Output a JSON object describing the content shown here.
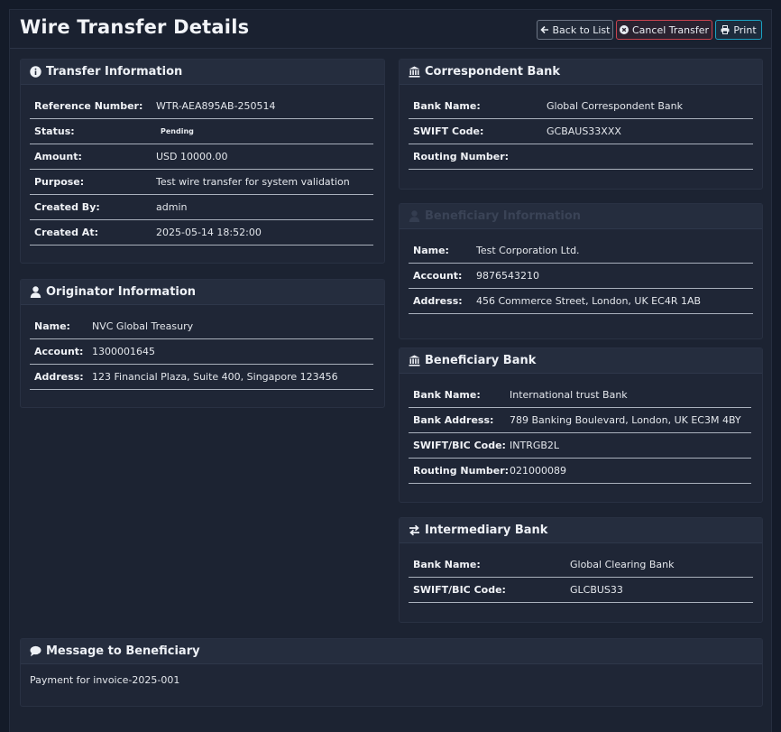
{
  "page": {
    "title": "Wire Transfer Details",
    "buttons": {
      "back": "Back to List",
      "cancel": "Cancel Transfer",
      "print": "Print"
    }
  },
  "transfer": {
    "title": "Transfer Information",
    "labels": {
      "reference": "Reference Number:",
      "status": "Status:",
      "amount": "Amount:",
      "purpose": "Purpose:",
      "created_by": "Created By:",
      "created_at": "Created At:"
    },
    "values": {
      "reference": "WTR-AEA895AB-250514",
      "status": "Pending",
      "amount": "USD 10000.00",
      "purpose": "Test wire transfer for system validation",
      "created_by": "admin",
      "created_at": "2025-05-14 18:52:00"
    }
  },
  "originator": {
    "title": "Originator Information",
    "labels": {
      "name": "Name:",
      "account": "Account:",
      "address": "Address:"
    },
    "values": {
      "name": "NVC Global Treasury",
      "account": "1300001645",
      "address": "123 Financial Plaza, Suite 400, Singapore 123456"
    }
  },
  "correspondent": {
    "title": "Correspondent Bank",
    "labels": {
      "bank_name": "Bank Name:",
      "swift": "SWIFT Code:",
      "routing": "Routing Number:"
    },
    "values": {
      "bank_name": "Global Correspondent Bank",
      "swift": "GCBAUS33XXX",
      "routing": ""
    }
  },
  "beneficiary": {
    "title": "Beneficiary Information",
    "labels": {
      "name": "Name:",
      "account": "Account:",
      "address": "Address:"
    },
    "values": {
      "name": "Test Corporation Ltd.",
      "account": "9876543210",
      "address": "456 Commerce Street, London, UK EC4R 1AB"
    }
  },
  "beneficiary_bank": {
    "title": "Beneficiary Bank",
    "labels": {
      "bank_name": "Bank Name:",
      "bank_address": "Bank Address:",
      "swift": "SWIFT/BIC Code:",
      "routing": "Routing Number:"
    },
    "values": {
      "bank_name": "International trust Bank",
      "bank_address": "789 Banking Boulevard, London, UK EC3M 4BY",
      "swift": "INTRGB2L",
      "routing": "021000089"
    }
  },
  "intermediary": {
    "title": "Intermediary Bank",
    "labels": {
      "bank_name": "Bank Name:",
      "swift": "SWIFT/BIC Code:"
    },
    "values": {
      "bank_name": "Global Clearing Bank",
      "swift": "GLCBUS33"
    }
  },
  "message": {
    "title": "Message to Beneficiary",
    "text": "Payment for invoice-2025-001"
  },
  "icons": {
    "info": "info-circle-icon",
    "user": "user-icon",
    "bank": "bank-icon",
    "exchange": "exchange-arrows-icon",
    "comment": "comment-icon",
    "back": "arrow-left-icon",
    "cancel": "times-circle-icon",
    "print": "printer-icon"
  },
  "colors": {
    "cancel_border": "#c9434f",
    "print_border": "#1aa2c3",
    "background": "#1c2332"
  }
}
